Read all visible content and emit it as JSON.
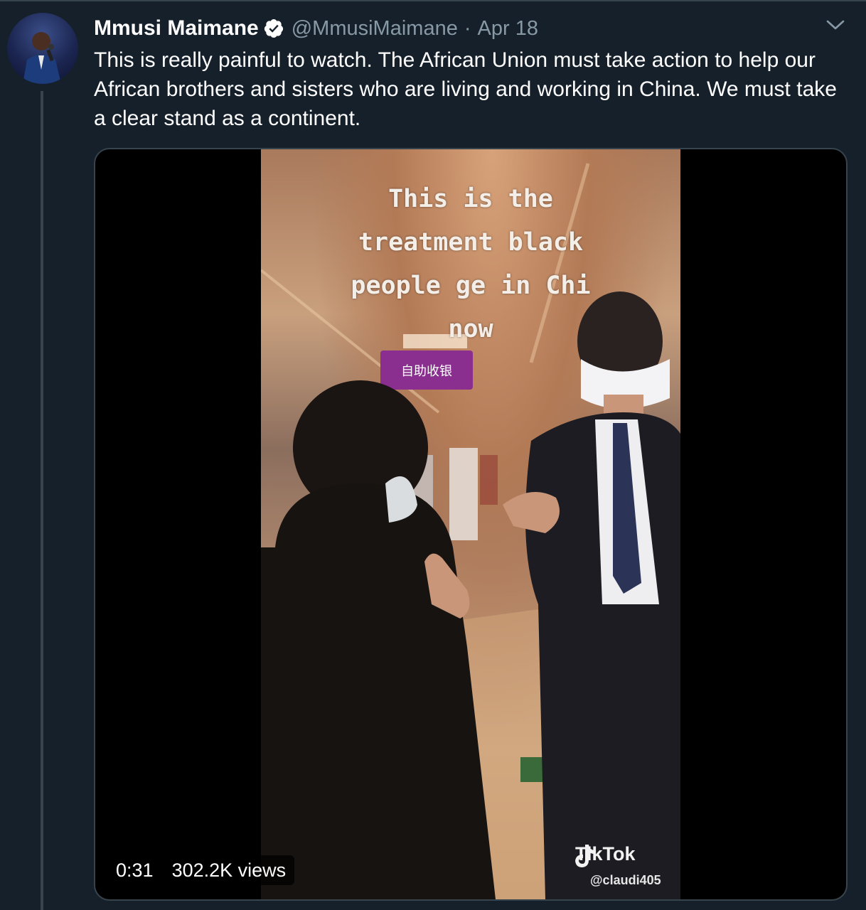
{
  "tweet": {
    "author_name": "Mmusi Maimane",
    "handle": "@MmusiMaimane",
    "separator": "·",
    "date": "Apr 18",
    "text": "This is really painful to watch. The African Union must take action to help our African brothers and sisters who are living and working in China. We must take a clear stand as a continent."
  },
  "media": {
    "caption": "This is the\ntreatment black\npeople ge in Chi\nnow",
    "store_sign": "自助收银",
    "watermark_brand": "TikTok",
    "watermark_user": "@claudi405",
    "duration": "0:31",
    "views": "302.2K views"
  },
  "colors": {
    "background": "#15202b",
    "secondary_text": "#8899a6",
    "border": "#38444d",
    "verified": "#ffffff"
  },
  "icons": {
    "verified": "verified-badge-icon",
    "caret": "chevron-down-icon",
    "tiktok": "tiktok-logo-icon"
  }
}
